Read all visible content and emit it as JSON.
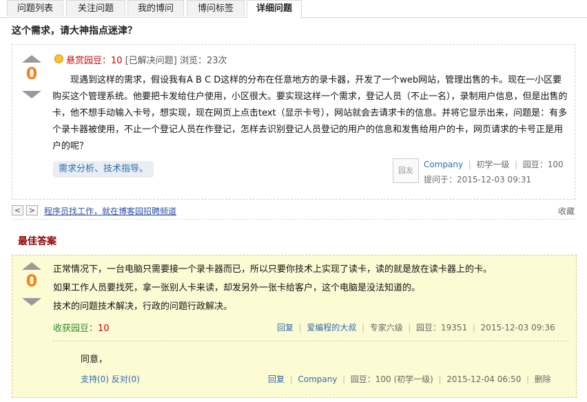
{
  "tabs": [
    "问题列表",
    "关注问题",
    "我的博问",
    "博问标签",
    "详细问题"
  ],
  "question": {
    "title": "这个需求，请大神指点迷津？",
    "votes": "0",
    "reward_label": "悬赏园豆：",
    "reward_value": "10",
    "status": "[已解决问题]",
    "views": "浏览：23次",
    "body": "现遇到这样的需求，假设我有A B C D这样的分布在任意地方的录卡器，开发了一个web网站，管理出售的卡。现在一小区要购买这个管理系统。他要把卡发给住户使用，小区很大。要实现这样一个需求，登记人员（不止一名），录制用户信息，但是出售的卡，他不想手动输入卡号，想实现，现在网页上点击text（显示卡号），网站就会去请求卡的信息。并将它显示出来，问题是：有多个录卡器被使用，不止一个登记人员在作登记，怎样去识别登记人员登记的用户的信息和发售给用户的卡，网页请求的卡号正是用户的呢？",
    "tag": "需求分析、技术指导。",
    "avatar_text": "园友",
    "author": "Company",
    "level": "初学一级",
    "beans": "园豆：100",
    "asked": "提问于：2015-12-03 09:31"
  },
  "nav": {
    "prev": "<",
    "next": ">",
    "ad_link": "程序员找工作，就在博客园招聘频道",
    "favorite": "收藏"
  },
  "best_answer": {
    "section_title": "最佳答案",
    "votes": "0",
    "lines": [
      "正常情况下，一台电脑只需要接一个录卡器而已，所以只要你技术上实现了读卡，读的就是放在读卡器上的卡。",
      "如果工作人员要找死，拿一张别人卡来读，却发另外一张卡给客户，这个电脑是没法知道的。",
      "技术的问题技术解决，行政的问题行政解决。"
    ],
    "earned_label": "收获园豆：",
    "earned_value": "10",
    "reply_label": "回复",
    "author": "爱编程的大叔",
    "level": "专家六级",
    "beans": "园豆：19351",
    "time": "2015-12-03 09:36"
  },
  "comment": {
    "text": "同意，",
    "support": "支持(0)",
    "oppose": "反对(0)",
    "reply_label": "回复",
    "author": "Company",
    "beans": "园豆：100 (初学一级)",
    "time": "2015-12-04 06:50",
    "delete_label": "删除"
  },
  "colors": {
    "vote": "#f58220",
    "reward": "#cc0000",
    "link": "#2b6cb0",
    "answer_bg": "#fdfbd4",
    "best_title": "#8b0000"
  }
}
